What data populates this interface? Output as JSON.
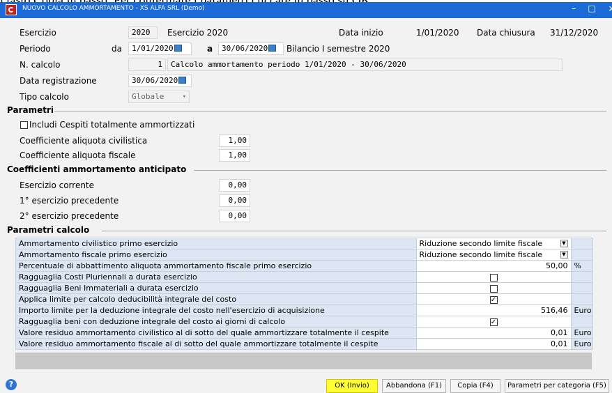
{
  "page_caption": "l tasto Copia in basso. Per confermare i parametri cliccare in basso su OK.",
  "window": {
    "title": "NUOVO CALCOLO AMMORTAMENTO - XS ALFA SRL (Demo)",
    "minimize": "–",
    "maximize": "□",
    "close": "x"
  },
  "header": {
    "esercizio_label": "Esercizio",
    "esercizio_value": "2020",
    "esercizio_desc": "Esercizio 2020",
    "data_inizio_label": "Data inizio",
    "data_inizio_value": "1/01/2020",
    "data_chiusura_label": "Data chiusura",
    "data_chiusura_value": "31/12/2020",
    "periodo_label": "Periodo",
    "da_label": "da",
    "periodo_da": "1/01/2020",
    "a_label": "a",
    "periodo_a": "30/06/2020",
    "periodo_desc": "Bilancio I semestre 2020",
    "ncalcolo_label": "N. calcolo",
    "ncalcolo_value": "1",
    "ncalcolo_desc": "Calcolo ammortamento periodo 1/01/2020 - 30/06/2020",
    "data_reg_label": "Data registrazione",
    "data_reg_value": "30/06/2020",
    "tipo_label": "Tipo calcolo",
    "tipo_value": "Globale",
    "tipo_arrow": "▾"
  },
  "parametri": {
    "title": "Parametri",
    "includi_label": "Includi Cespiti totalmente ammortizzati",
    "includi_checked": false,
    "coeff_civ_label": "Coefficiente aliquota civilistica",
    "coeff_civ_value": "1,00",
    "coeff_fisc_label": "Coefficiente aliquota fiscale",
    "coeff_fisc_value": "1,00"
  },
  "anticipato": {
    "title": "Coefficienti ammortamento anticipato",
    "corrente_label": "Esercizio corrente",
    "corrente_value": "0,00",
    "prec1_label": "1° esercizio precedente",
    "prec1_value": "0,00",
    "prec2_label": "2° esercizio precedente",
    "prec2_value": "0,00"
  },
  "calcolo": {
    "title": "Parametri calcolo",
    "rows": [
      {
        "label": "Ammortamento civilistico primo esercizio",
        "type": "select",
        "value": "Riduzione secondo limite fiscale",
        "unit": ""
      },
      {
        "label": "Ammortamento fiscale primo esercizio",
        "type": "select",
        "value": "Riduzione secondo limite fiscale",
        "unit": ""
      },
      {
        "label": "Percentuale di abbattimento aliquota ammortamento fiscale primo esercizio",
        "type": "number",
        "value": "50,00",
        "unit": "%"
      },
      {
        "label": "Ragguaglia Costi Pluriennali a durata esercizio",
        "type": "check",
        "checked": false,
        "unit": ""
      },
      {
        "label": "Ragguaglia Beni Immateriali a durata esercizio",
        "type": "check",
        "checked": false,
        "unit": ""
      },
      {
        "label": "Applica limite per calcolo deducibilità integrale del costo",
        "type": "check",
        "checked": true,
        "unit": ""
      },
      {
        "label": "Importo limite per la deduzione integrale del costo nell'esercizio di acquisizione",
        "type": "number",
        "value": "516,46",
        "unit": "Euro"
      },
      {
        "label": "Ragguaglia beni con deduzione integrale del costo ai giorni di calcolo",
        "type": "check",
        "checked": true,
        "unit": ""
      },
      {
        "label": "Valore residuo ammortamento civilistico al di sotto del quale ammortizzare totalmente il cespite",
        "type": "number",
        "value": "0,01",
        "unit": "Euro"
      },
      {
        "label": "Valore residuo ammortamento fiscale al di sotto del quale ammortizzare totalmente il cespite",
        "type": "number",
        "value": "0,01",
        "unit": "Euro"
      }
    ]
  },
  "footer": {
    "help_icon": "?",
    "ok_label": "OK (Invio)",
    "abbandona_label": "Abbandona (F1)",
    "copia_label": "Copia (F4)",
    "parametri_label": "Parametri per categoria (F5)",
    "ok_highlight": "#ffff33"
  },
  "colors": {
    "titlebar": "#1c6ad6",
    "grid_label_bg": "#dde6f3",
    "client_bg": "#f2f2f2"
  }
}
